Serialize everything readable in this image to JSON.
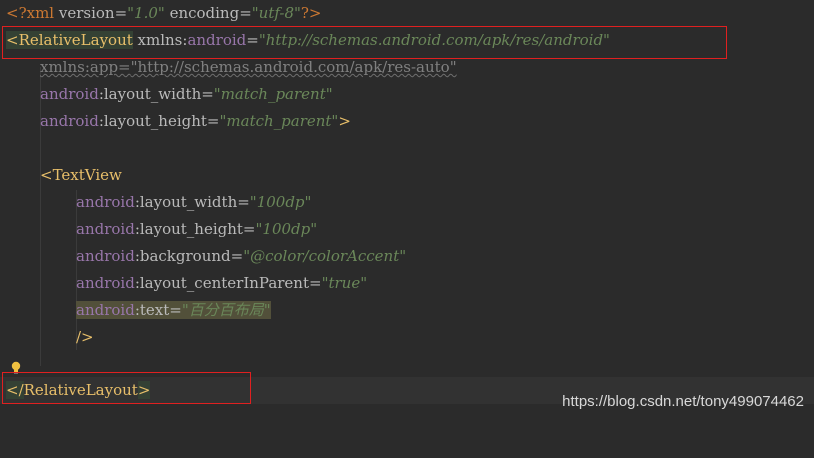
{
  "code": {
    "xml_decl_open": "<?xml",
    "xml_version_attr": " version=",
    "xml_version_val": "\"1.0\"",
    "xml_encoding_attr": " encoding=",
    "xml_encoding_val": "\"utf-8\"",
    "xml_decl_close": "?>",
    "rl_open_bracket": "<",
    "rl_tag": "RelativeLayout",
    "rl_xmlns": " xmlns:",
    "rl_xmlns_ns": "android",
    "rl_xmlns_eq": "=",
    "rl_xmlns_val": "\"http://schemas.android.com/apk/res/android\"",
    "app_xmlns": "xmlns:app=",
    "app_xmlns_val": "\"http://schemas.android.com/apk/res-auto\"",
    "lw_ns": "android",
    "lw_attr": ":layout_width=",
    "lw_val": "\"match_parent\"",
    "lh_ns": "android",
    "lh_attr": ":layout_height=",
    "lh_val": "\"match_parent\"",
    "lh_close": ">",
    "tv_open_bracket": "<",
    "tv_tag": "TextView",
    "tv_lw_ns": "android",
    "tv_lw_attr": ":layout_width=",
    "tv_lw_val": "\"100dp\"",
    "tv_lh_ns": "android",
    "tv_lh_attr": ":layout_height=",
    "tv_lh_val": "\"100dp\"",
    "tv_bg_ns": "android",
    "tv_bg_attr": ":background=",
    "tv_bg_val": "\"@color/colorAccent\"",
    "tv_cip_ns": "android",
    "tv_cip_attr": ":layout_centerInParent=",
    "tv_cip_val": "\"true\"",
    "tv_text_ns": "android",
    "tv_text_attr": ":text=",
    "tv_text_val": "\"百分百布局\"",
    "tv_self_close": "/>",
    "rl_close_open": "</",
    "rl_close_tag": "RelativeLayout",
    "rl_close_bracket": ">"
  },
  "watermark": "https://blog.csdn.net/tony499074462",
  "icons": {
    "bulb": "lightbulb-icon"
  },
  "colors": {
    "background": "#2b2b2b",
    "tag": "#e8bf6a",
    "namespace": "#9876aa",
    "value": "#6a8759",
    "annotation_box": "#e02020"
  }
}
